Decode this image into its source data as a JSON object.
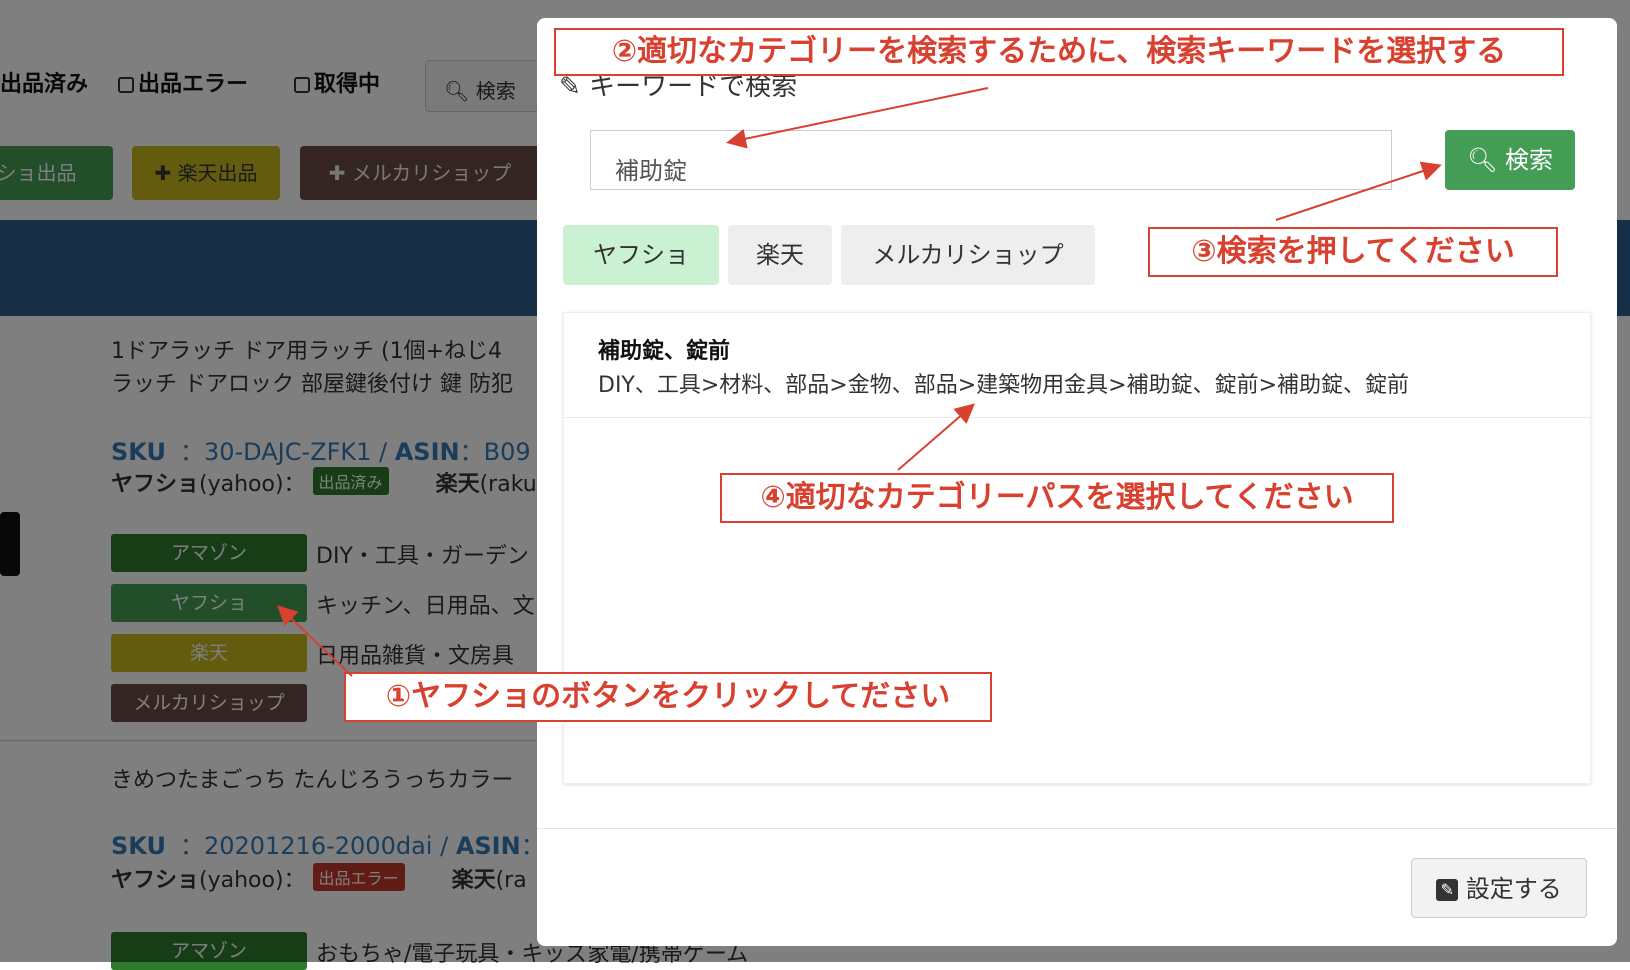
{
  "background": {
    "filters": {
      "listed": "出品済み",
      "listing_error": "出品エラー",
      "fetching": "取得中",
      "search": "検索"
    },
    "action_buttons": {
      "yahoo": "ヤフショ出品",
      "rakuten": "楽天出品",
      "mercari": "メルカリショップ"
    },
    "products": [
      {
        "title_line1": "1ドアラッチ ドア用ラッチ (1個+ねじ4",
        "title_line2": "ラッチ ドアロック 部屋鍵後付け 鍵 防犯",
        "sku_label": "SKU",
        "sku_value": "：30-DAJC-ZFK1 /",
        "asin_label": "ASIN",
        "asin_value": "：B09",
        "yahoo_label": "ヤフショ",
        "yahoo_suffix": "(yahoo)：",
        "yahoo_status": "出品済み",
        "rakuten_label": "楽天",
        "rakuten_suffix": "(raku",
        "categories": [
          {
            "marketplace": "アマゾン",
            "path": "DIY・工具・ガーデン"
          },
          {
            "marketplace": "ヤフショ",
            "path": "キッチン、日用品、文"
          },
          {
            "marketplace": "楽天",
            "path": "日用品雑貨・文房具"
          },
          {
            "marketplace": "メルカリショップ",
            "path": ""
          }
        ]
      },
      {
        "title_line1": "きめつたまごっち たんじろうっちカラー",
        "sku_label": "SKU",
        "sku_value": "：20201216-2000dai /",
        "asin_label": "ASIN",
        "asin_value": "：",
        "yahoo_label": "ヤフショ",
        "yahoo_suffix": "(yahoo)：",
        "yahoo_status": "出品エラー",
        "rakuten_label": "楽天",
        "rakuten_suffix": "(ra",
        "categories": [
          {
            "marketplace": "アマゾン",
            "path": "おもちゃ/電子玩具・キッズ家電/携帯ゲーム"
          }
        ]
      }
    ]
  },
  "modal": {
    "title": "キーワードで検索",
    "keyword_value": "補助錠",
    "search_button": "検索",
    "tabs": [
      {
        "label": "ヤフショ",
        "active": true
      },
      {
        "label": "楽天",
        "active": false
      },
      {
        "label": "メルカリショップ",
        "active": false
      }
    ],
    "results": [
      {
        "name": "補助錠、錠前",
        "path": "DIY、工具>材料、部品>金物、部品>建築物用金具>補助錠、錠前>補助錠、錠前"
      }
    ],
    "save_button": "設定する"
  },
  "annotations": {
    "step1": "①ヤフショのボタンをクリックしてださい",
    "step2": "②適切なカテゴリーを検索するために、検索キーワードを選択する",
    "step3": "③検索を押してください",
    "step4": "④適切なカテゴリーパスを選択してください",
    "color": "#d8412f"
  },
  "colors": {
    "yahoo": "#449d54",
    "rakuten": "#c7b81f",
    "mercari": "#6b4a45",
    "amazon": "#2f7a2f",
    "tab_active": "#c9f1d2",
    "tab_inactive": "#eeeeee"
  }
}
